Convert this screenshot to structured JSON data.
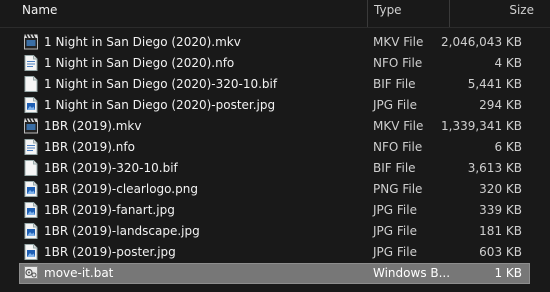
{
  "header": {
    "name_label": "Name",
    "type_label": "Type",
    "size_label": "Size",
    "sort_indicator": "^"
  },
  "files": [
    {
      "name": "1 Night in San Diego (2020).mkv",
      "type": "MKV File",
      "size": "2,046,043 KB",
      "icon": "video-file-icon",
      "selected": false
    },
    {
      "name": "1 Night in San Diego (2020).nfo",
      "type": "NFO File",
      "size": "4 KB",
      "icon": "nfo-file-icon",
      "selected": false
    },
    {
      "name": "1 Night in San Diego (2020)-320-10.bif",
      "type": "BIF File",
      "size": "5,441 KB",
      "icon": "generic-file-icon",
      "selected": false
    },
    {
      "name": "1 Night in San Diego (2020)-poster.jpg",
      "type": "JPG File",
      "size": "294 KB",
      "icon": "image-file-icon",
      "selected": false
    },
    {
      "name": "1BR (2019).mkv",
      "type": "MKV File",
      "size": "1,339,341 KB",
      "icon": "video-file-icon",
      "selected": false
    },
    {
      "name": "1BR (2019).nfo",
      "type": "NFO File",
      "size": "6 KB",
      "icon": "nfo-file-icon",
      "selected": false
    },
    {
      "name": "1BR (2019)-320-10.bif",
      "type": "BIF File",
      "size": "3,613 KB",
      "icon": "generic-file-icon",
      "selected": false
    },
    {
      "name": "1BR (2019)-clearlogo.png",
      "type": "PNG File",
      "size": "320 KB",
      "icon": "image-file-icon",
      "selected": false
    },
    {
      "name": "1BR (2019)-fanart.jpg",
      "type": "JPG File",
      "size": "339 KB",
      "icon": "image-file-icon",
      "selected": false
    },
    {
      "name": "1BR (2019)-landscape.jpg",
      "type": "JPG File",
      "size": "181 KB",
      "icon": "image-file-icon",
      "selected": false
    },
    {
      "name": "1BR (2019)-poster.jpg",
      "type": "JPG File",
      "size": "603 KB",
      "icon": "image-file-icon",
      "selected": false
    },
    {
      "name": "move-it.bat",
      "type": "Windows B...",
      "size": "1 KB",
      "icon": "batch-file-icon",
      "selected": true
    }
  ],
  "colors": {
    "background": "#191919",
    "selection": "#777777",
    "text": "#f2f2f2",
    "secondary_text": "#cfcfcf"
  }
}
